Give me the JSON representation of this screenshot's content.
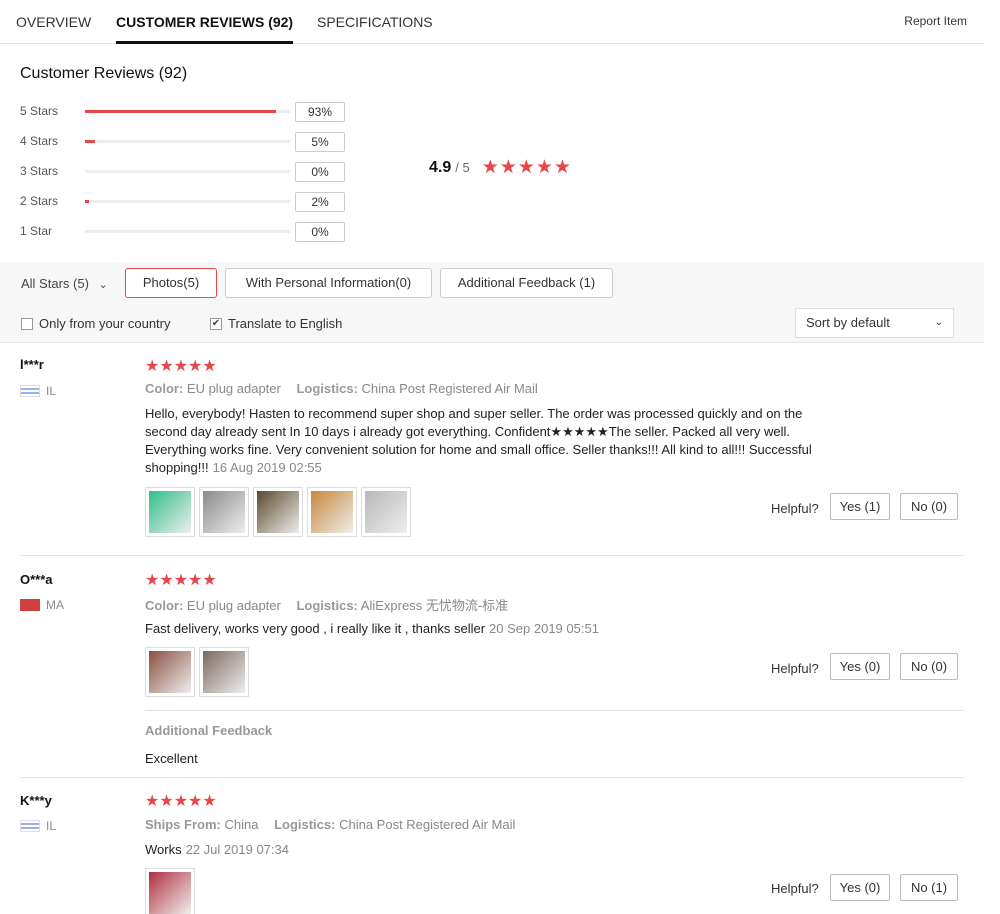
{
  "tabs": {
    "overview": "OVERVIEW",
    "reviews": "CUSTOMER REVIEWS (92)",
    "specs": "SPECIFICATIONS",
    "report": "Report Item"
  },
  "summary": {
    "title": "Customer Reviews (92)",
    "distribution": [
      {
        "label": "5 Stars",
        "percent": "93%",
        "fill": 0.93
      },
      {
        "label": "4 Stars",
        "percent": "5%",
        "fill": 0.05
      },
      {
        "label": "3 Stars",
        "percent": "0%",
        "fill": 0.0
      },
      {
        "label": "2 Stars",
        "percent": "2%",
        "fill": 0.02
      },
      {
        "label": "1 Star",
        "percent": "0%",
        "fill": 0.0
      }
    ],
    "average": "4.9",
    "out_of": "/ 5",
    "stars": "★★★★★"
  },
  "filters": {
    "all_stars": "All Stars (5)",
    "caret": "⌄",
    "photos": "Photos(5)",
    "personal": "With Personal Information(0)",
    "additional": "Additional Feedback (1)",
    "only_country": "Only from your country",
    "translate": "Translate to English",
    "translate_checked": "✔",
    "sort": "Sort by default",
    "sort_caret": "⌄"
  },
  "reviews": [
    {
      "name": "l***r",
      "country": "IL",
      "stars": "★★★★★",
      "meta1_label": "Color:",
      "meta1_value": "EU plug adapter",
      "meta2_label": "Logistics:",
      "meta2_value": "China Post Registered Air Mail",
      "text": "Hello, everybody! Hasten to recommend super shop and super seller. The order was processed quickly and on the second day already sent In 10 days i already got everything. Confident★★★★★The seller. Packed all very well. Everything works fine. Very convenient solution for home and small office. Seller thanks!!! All kind to all!!! Successful shopping!!!",
      "date": "16 Aug 2019 02:55",
      "helpful": "Helpful?",
      "yes": "Yes (1)",
      "no": "No (0)",
      "thumb_colors": [
        "#2fbf8a",
        "#8a8a8a",
        "#5a4a2a",
        "#c8873a",
        "#b8b8b8"
      ]
    },
    {
      "name": "O***a",
      "country": "MA",
      "stars": "★★★★★",
      "meta1_label": "Color:",
      "meta1_value": "EU plug adapter",
      "meta2_label": "Logistics:",
      "meta2_value": "AliExpress 无忧物流-标准",
      "text": "Fast delivery, works very good , i really like it , thanks seller",
      "date": "20 Sep 2019 05:51",
      "helpful": "Helpful?",
      "yes": "Yes (0)",
      "no": "No (0)",
      "additional_title": "Additional Feedback",
      "additional_text": "Excellent",
      "thumb_colors": [
        "#8a5040",
        "#7a6a60"
      ]
    },
    {
      "name": "K***y",
      "country": "IL",
      "stars": "★★★★★",
      "meta1_label": "Ships From:",
      "meta1_value": "China",
      "meta2_label": "Logistics:",
      "meta2_value": "China Post Registered Air Mail",
      "text": "Works",
      "date": "22 Jul 2019 07:34",
      "helpful": "Helpful?",
      "yes": "Yes (0)",
      "no": "No (1)",
      "thumb_colors": [
        "#b03040"
      ]
    }
  ],
  "colors": {
    "accent": "#e8474a"
  }
}
